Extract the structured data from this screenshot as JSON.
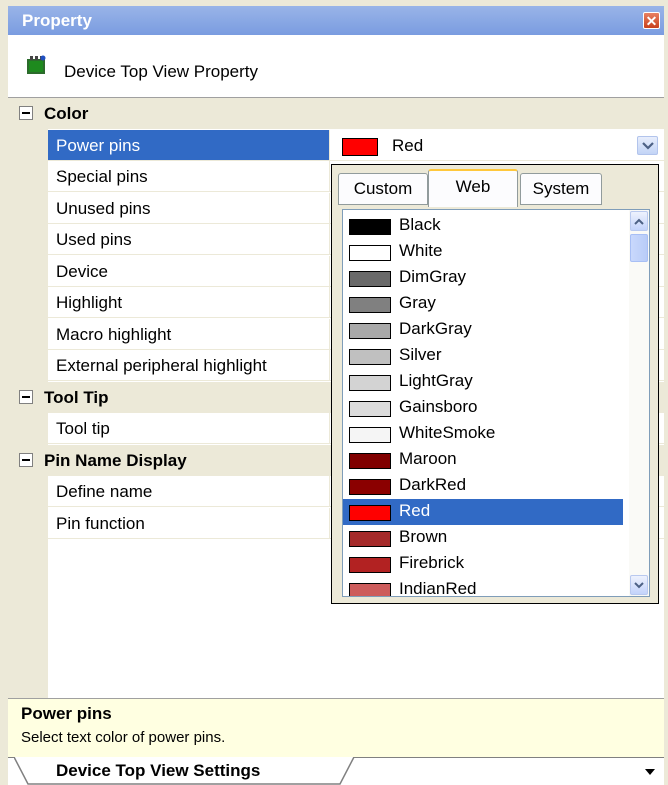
{
  "panel": {
    "title": "Property",
    "close_glyph": "✕"
  },
  "object": {
    "label": "Device Top View Property",
    "icon": "chip-icon"
  },
  "grid": {
    "categories": [
      {
        "label": "Color",
        "properties": [
          "Power pins",
          "Special pins",
          "Unused pins",
          "Used pins",
          "Device",
          "Highlight",
          "Macro highlight",
          "External peripheral highlight"
        ]
      },
      {
        "label": "Tool Tip",
        "properties": [
          "Tool tip"
        ]
      },
      {
        "label": "Pin Name Display",
        "properties": [
          "Define name",
          "Pin function"
        ]
      }
    ],
    "selected_property": "Power pins",
    "selected_value": {
      "text": "Red",
      "color": "#ff0000"
    }
  },
  "color_picker": {
    "tabs": [
      "Custom",
      "Web",
      "System"
    ],
    "active_tab": "Web",
    "colors": [
      {
        "name": "Black",
        "hex": "#000000"
      },
      {
        "name": "White",
        "hex": "#ffffff"
      },
      {
        "name": "DimGray",
        "hex": "#696969"
      },
      {
        "name": "Gray",
        "hex": "#808080"
      },
      {
        "name": "DarkGray",
        "hex": "#a9a9a9"
      },
      {
        "name": "Silver",
        "hex": "#c0c0c0"
      },
      {
        "name": "LightGray",
        "hex": "#d3d3d3"
      },
      {
        "name": "Gainsboro",
        "hex": "#dcdcdc"
      },
      {
        "name": "WhiteSmoke",
        "hex": "#f5f5f5"
      },
      {
        "name": "Maroon",
        "hex": "#800000"
      },
      {
        "name": "DarkRed",
        "hex": "#8b0000"
      },
      {
        "name": "Red",
        "hex": "#ff0000"
      },
      {
        "name": "Brown",
        "hex": "#a52a2a"
      },
      {
        "name": "Firebrick",
        "hex": "#b22222"
      },
      {
        "name": "IndianRed",
        "hex": "#cd5c5c"
      }
    ],
    "selected_color": "Red"
  },
  "help": {
    "title": "Power pins",
    "description": "Select text color of power pins."
  },
  "bottom_tab": {
    "label": "Device Top View Settings"
  }
}
